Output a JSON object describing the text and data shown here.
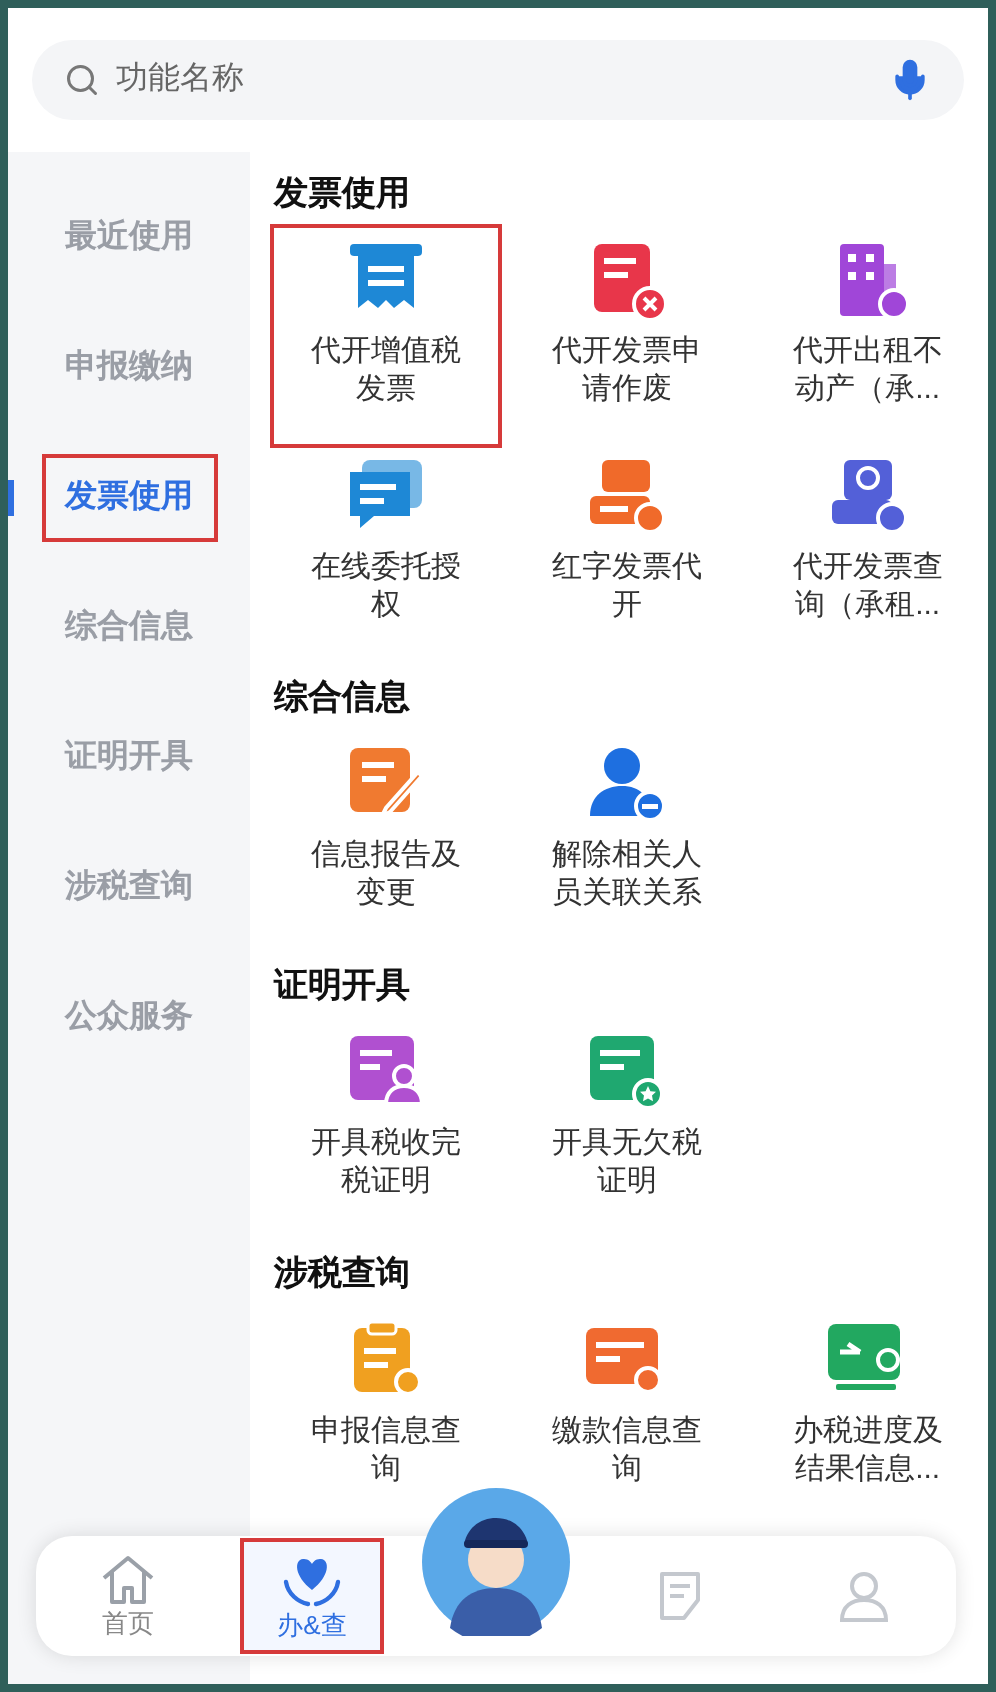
{
  "search": {
    "placeholder": "功能名称"
  },
  "sidebar": {
    "items": [
      {
        "label": "最近使用",
        "selected": false,
        "highlighted": false
      },
      {
        "label": "申报缴纳",
        "selected": false,
        "highlighted": false
      },
      {
        "label": "发票使用",
        "selected": true,
        "highlighted": true
      },
      {
        "label": "综合信息",
        "selected": false,
        "highlighted": false
      },
      {
        "label": "证明开具",
        "selected": false,
        "highlighted": false
      },
      {
        "label": "涉税查询",
        "selected": false,
        "highlighted": false
      },
      {
        "label": "公众服务",
        "selected": false,
        "highlighted": false
      }
    ]
  },
  "sections": [
    {
      "title": "发票使用",
      "items": [
        {
          "label": "代开增值税发票",
          "kind": "receipt",
          "color": "#1e88d6",
          "highlighted": true
        },
        {
          "label": "代开发票申请作废",
          "kind": "docx",
          "color": "#e8364a",
          "highlighted": false
        },
        {
          "label": "代开出租不动产（承...",
          "kind": "building",
          "color": "#a046d8",
          "highlighted": false
        },
        {
          "label": "在线委托授权",
          "kind": "chat",
          "color": "#1e88d6",
          "highlighted": false
        },
        {
          "label": "红字发票代开",
          "kind": "stamp",
          "color": "#f06a2a",
          "highlighted": false
        },
        {
          "label": "代开发票查询（承租...",
          "kind": "lookup",
          "color": "#5360d8",
          "highlighted": false
        }
      ]
    },
    {
      "title": "综合信息",
      "items": [
        {
          "label": "信息报告及变更",
          "kind": "edit",
          "color": "#f07a30",
          "highlighted": false
        },
        {
          "label": "解除相关人员关联关系",
          "kind": "person",
          "color": "#1e6fe0",
          "highlighted": false
        }
      ]
    },
    {
      "title": "证明开具",
      "items": [
        {
          "label": "开具税收完税证明",
          "kind": "certificate",
          "color": "#b050d0",
          "highlighted": false
        },
        {
          "label": "开具无欠税证明",
          "kind": "star",
          "color": "#1fa870",
          "highlighted": false
        }
      ]
    },
    {
      "title": "涉税查询",
      "items": [
        {
          "label": "申报信息查询",
          "kind": "clipboard",
          "color": "#f0a020",
          "highlighted": false
        },
        {
          "label": "缴款信息查询",
          "kind": "card",
          "color": "#f06a30",
          "highlighted": false
        },
        {
          "label": "办税进度及结果信息...",
          "kind": "monitor",
          "color": "#22a860",
          "highlighted": false
        }
      ]
    }
  ],
  "nav": {
    "tabs": [
      {
        "kind": "home",
        "label": "首页",
        "selected": false,
        "highlighted": false
      },
      {
        "kind": "heart",
        "label": "办&查",
        "selected": true,
        "highlighted": true
      },
      {
        "kind": "avatar"
      },
      {
        "kind": "note",
        "selected": false
      },
      {
        "kind": "user",
        "selected": false
      }
    ]
  }
}
